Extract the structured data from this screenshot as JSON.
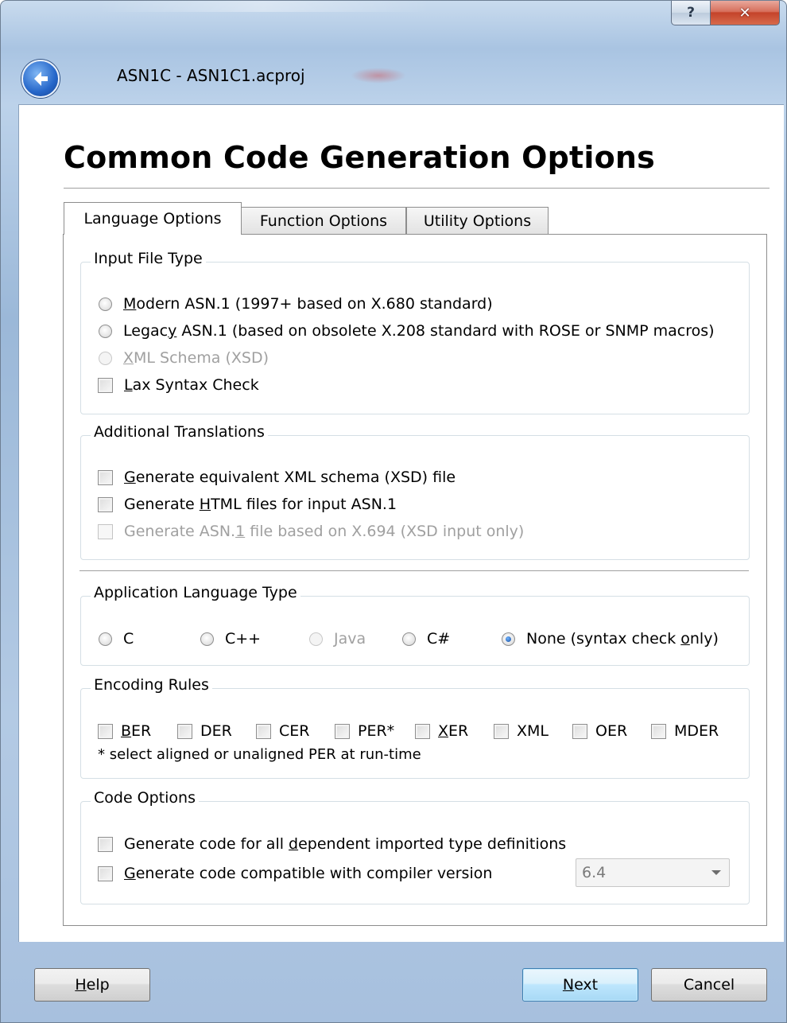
{
  "window": {
    "title": "ASN1C - ASN1C1.acproj",
    "help_glyph": "?",
    "close_glyph": "✕"
  },
  "page": {
    "heading": "Common Code Generation Options"
  },
  "tabs": [
    {
      "label": "Language Options",
      "active": true
    },
    {
      "label": "Function Options",
      "active": false
    },
    {
      "label": "Utility Options",
      "active": false
    }
  ],
  "input_file_type": {
    "title": "Input File Type",
    "modern": {
      "pre": "",
      "mn": "M",
      "post": "odern ASN.1 (1997+ based on X.680 standard)"
    },
    "legacy": {
      "pre": "Legac",
      "mn": "y",
      "post": " ASN.1 (based on obsolete X.208 standard with ROSE or SNMP macros)"
    },
    "xml": {
      "pre": "",
      "mn": "X",
      "post": "ML Schema (XSD)"
    },
    "lax": {
      "pre": "",
      "mn": "L",
      "post": "ax Syntax Check"
    }
  },
  "additional_translations": {
    "title": "Additional Translations",
    "xsd": {
      "pre": "",
      "mn": "G",
      "post": "enerate equivalent XML schema (XSD) file"
    },
    "html": {
      "pre": "Generate ",
      "mn": "H",
      "post": "TML files for input ASN.1"
    },
    "asn1": {
      "pre": "Generate ASN.",
      "mn": "1",
      "post": " file based on X.694 (XSD input only)"
    }
  },
  "application_language": {
    "title": "Application Language Type",
    "c": "C",
    "cpp": "C++",
    "java": {
      "pre": "",
      "mn": "J",
      "post": "ava"
    },
    "csharp": "C#",
    "none": {
      "pre": "None (syntax check ",
      "mn": "o",
      "post": "nly)"
    },
    "selected": "none"
  },
  "encoding_rules": {
    "title": "Encoding Rules",
    "ber": {
      "pre": "",
      "mn": "B",
      "post": "ER"
    },
    "der": "DER",
    "cer": "CER",
    "per": "PER*",
    "xer": {
      "pre": "",
      "mn": "X",
      "post": "ER"
    },
    "xml": "XML",
    "oer": "OER",
    "mder": "MDER",
    "note": "* select aligned or unaligned PER at run-time"
  },
  "code_options": {
    "title": "Code Options",
    "dependent": {
      "pre": "Generate code for all ",
      "mn": "d",
      "post": "ependent imported type definitions"
    },
    "compatible": {
      "pre": "",
      "mn": "G",
      "post": "enerate code compatible with compiler version"
    },
    "version_value": "6.4"
  },
  "buttons": {
    "help": {
      "pre": "",
      "mn": "H",
      "post": "elp"
    },
    "next": {
      "pre": "",
      "mn": "N",
      "post": "ext"
    },
    "cancel": "Cancel"
  }
}
